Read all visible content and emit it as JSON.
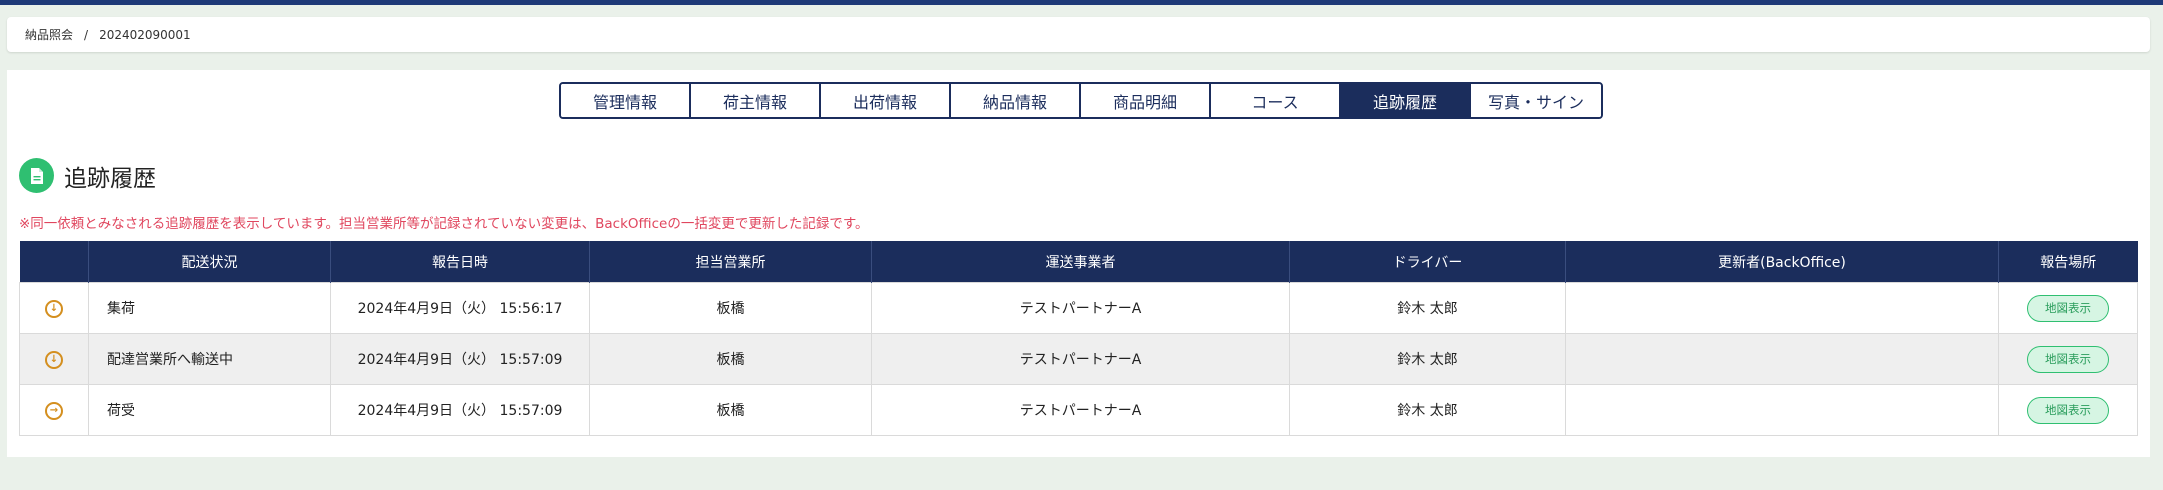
{
  "breadcrumb": {
    "parent": "納品照会",
    "separator": "/",
    "current": "202402090001"
  },
  "tabs": [
    {
      "label": "管理情報"
    },
    {
      "label": "荷主情報"
    },
    {
      "label": "出荷情報"
    },
    {
      "label": "納品情報"
    },
    {
      "label": "商品明細"
    },
    {
      "label": "コース"
    },
    {
      "label": "追跡履歴",
      "active": true
    },
    {
      "label": "写真・サイン"
    }
  ],
  "section": {
    "title": "追跡履歴",
    "icon": "document-icon"
  },
  "notice": "※同一依頼とみなされる追跡履歴を表示しています。担当営業所等が記録されていない変更は、BackOfficeの一括変更で更新した記録です。",
  "table": {
    "headers": [
      "",
      "配送状況",
      "報告日時",
      "担当営業所",
      "運送事業者",
      "ドライバー",
      "更新者(BackOffice)",
      "報告場所"
    ],
    "rows": [
      {
        "icon": "arrow-down-circle-icon",
        "status": "集荷",
        "datetime": "2024年4月9日（火） 15:56:17",
        "office": "板橋",
        "carrier": "テストパートナーA",
        "driver": "鈴木 太郎",
        "updater": "",
        "map_label": "地図表示"
      },
      {
        "icon": "arrow-down-circle-icon",
        "status": "配達営業所へ輸送中",
        "datetime": "2024年4月9日（火） 15:57:09",
        "office": "板橋",
        "carrier": "テストパートナーA",
        "driver": "鈴木 太郎",
        "updater": "",
        "map_label": "地図表示"
      },
      {
        "icon": "arrow-right-circle-icon",
        "status": "荷受",
        "datetime": "2024年4月9日（火） 15:57:09",
        "office": "板橋",
        "carrier": "テストパートナーA",
        "driver": "鈴木 太郎",
        "updater": "",
        "map_label": "地図表示"
      }
    ]
  },
  "colors": {
    "navy": "#1b2d5c",
    "accent_green": "#2fbf71",
    "notice_red": "#e0465e",
    "status_orange": "#d48f1f"
  }
}
